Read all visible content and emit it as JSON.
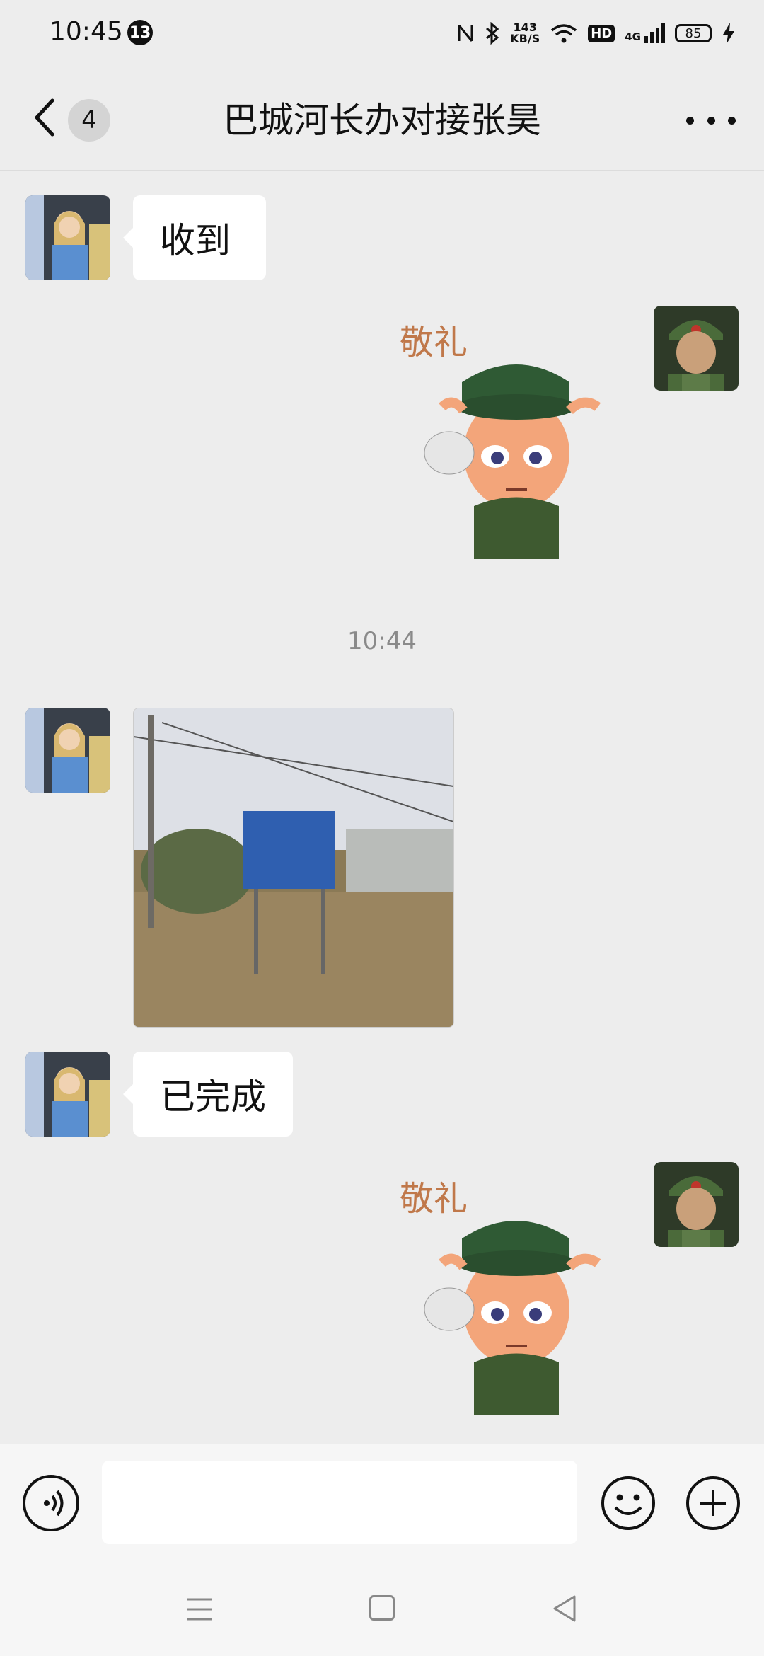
{
  "status_bar": {
    "time": "10:45",
    "notification_count": "13",
    "net_speed_value": "143",
    "net_speed_unit": "KB/S",
    "hd": "HD",
    "signal": "4G",
    "battery": "85"
  },
  "nav": {
    "unread_count": "4",
    "title": "巴城河长办对接张昊"
  },
  "messages": {
    "m1_text": "收到",
    "m2_sticker_text": "敬礼",
    "timestamp": "10:44",
    "m4_text": "已完成",
    "m5_sticker_text": "敬礼"
  },
  "input": {
    "placeholder": ""
  },
  "colors": {
    "background": "#ededed",
    "bubble": "#ffffff",
    "sticker_text": "#c0784a"
  }
}
